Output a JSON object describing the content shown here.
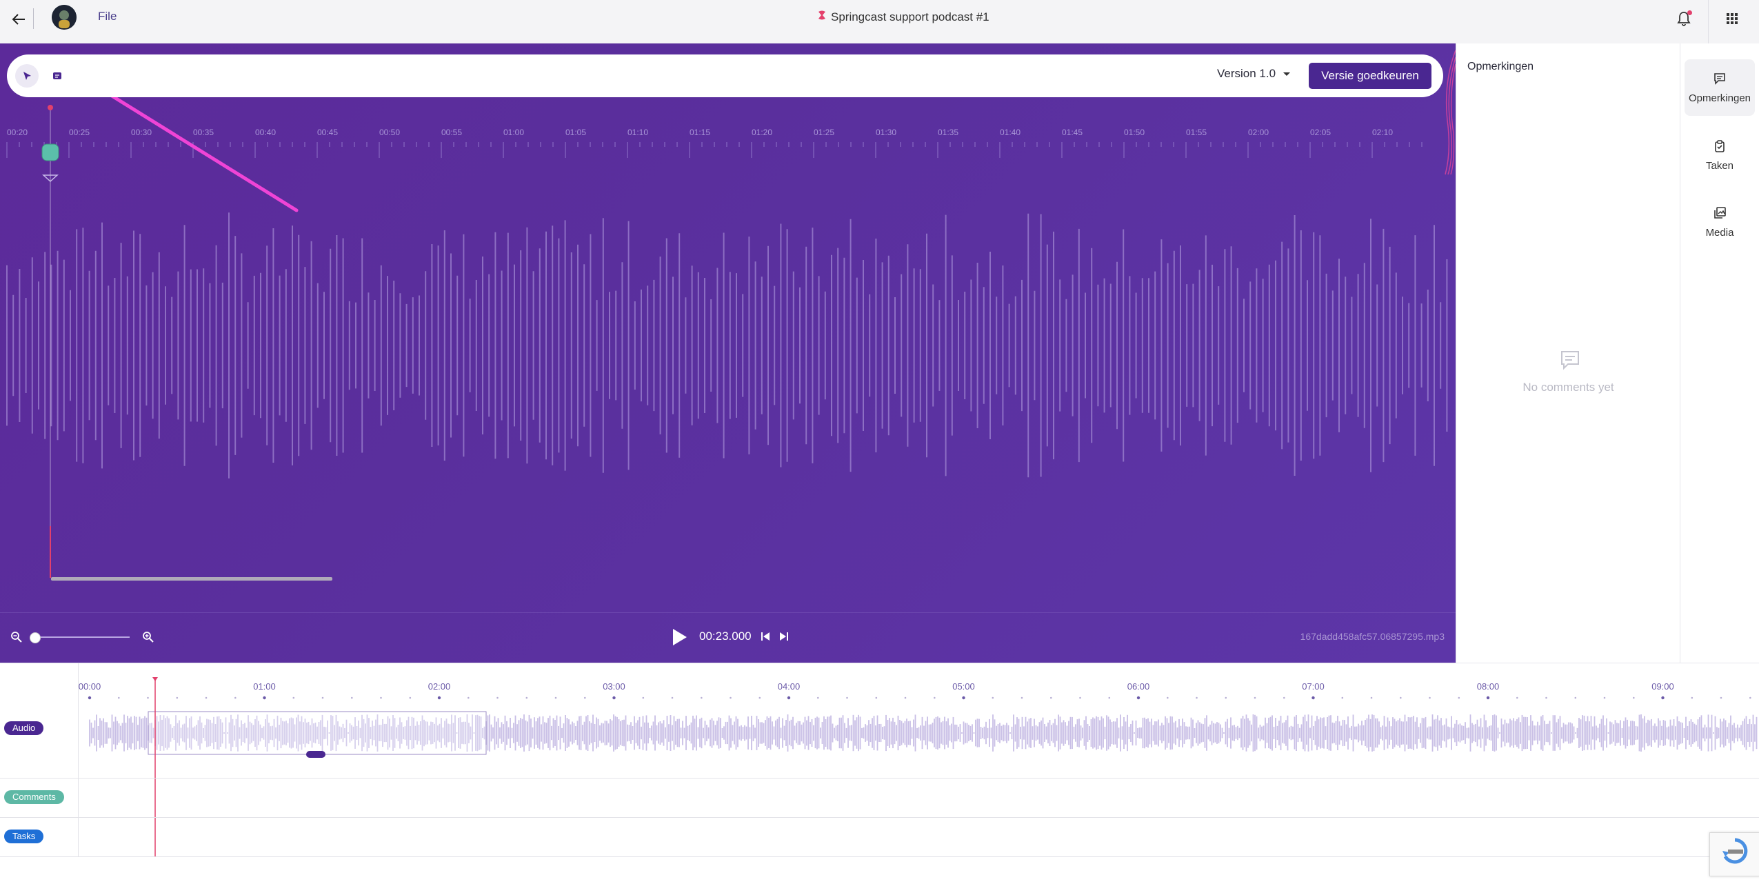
{
  "topbar": {
    "menu_file": "File",
    "title": "Springcast support podcast #1"
  },
  "editor": {
    "version_label": "Version 1.0",
    "approve_button": "Versie goedkeuren",
    "ruler_ticks": [
      "00:20",
      "00:25",
      "00:30",
      "00:35",
      "00:40",
      "00:45",
      "00:50",
      "00:55",
      "01:00",
      "01:05",
      "01:10",
      "01:15",
      "01:20",
      "01:25",
      "01:30",
      "01:35",
      "01:40",
      "01:45",
      "01:50",
      "01:55",
      "02:00",
      "02:05",
      "02:10"
    ],
    "timecode": "00:23.000",
    "filename": "167dadd458afc57.06857295.mp3"
  },
  "comments_panel": {
    "title": "Opmerkingen",
    "empty_text": "No comments yet"
  },
  "rail": {
    "comments": "Opmerkingen",
    "tasks": "Taken",
    "media": "Media"
  },
  "timeline": {
    "ticks": [
      "00:00",
      "01:00",
      "02:00",
      "03:00",
      "04:00",
      "05:00",
      "06:00",
      "07:00",
      "08:00",
      "09:00"
    ],
    "lanes": [
      "Audio",
      "Comments",
      "Tasks"
    ]
  },
  "colors": {
    "accent": "#4a2791",
    "stage": "#5c2e9e",
    "playhead": "#e2406c",
    "comments_tag": "#5db8a5",
    "tasks_tag": "#1f6fd6",
    "annotation_arrow": "#f044d6"
  }
}
